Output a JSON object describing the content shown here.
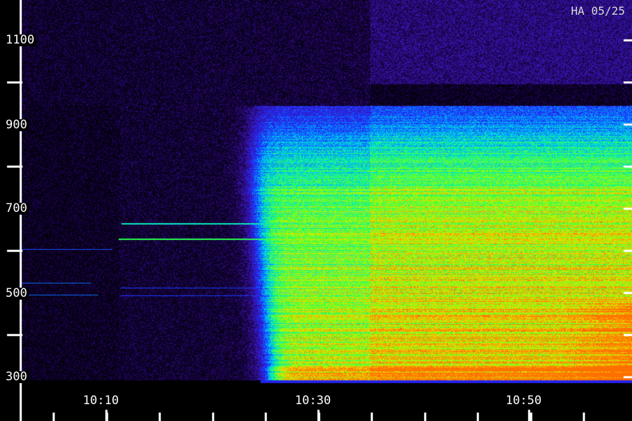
{
  "stamp": "HA 05/25",
  "y_ticks": [
    "1100",
    "900",
    "700",
    "500",
    "300"
  ],
  "x_ticks": [
    "10:10",
    "10:30",
    "10:50"
  ],
  "colors": {
    "background": "#000000",
    "axis": "#ffffff",
    "low": "#200060",
    "mid": "#0060ff",
    "high": "#30ff40",
    "peak": "#ffb000"
  }
}
